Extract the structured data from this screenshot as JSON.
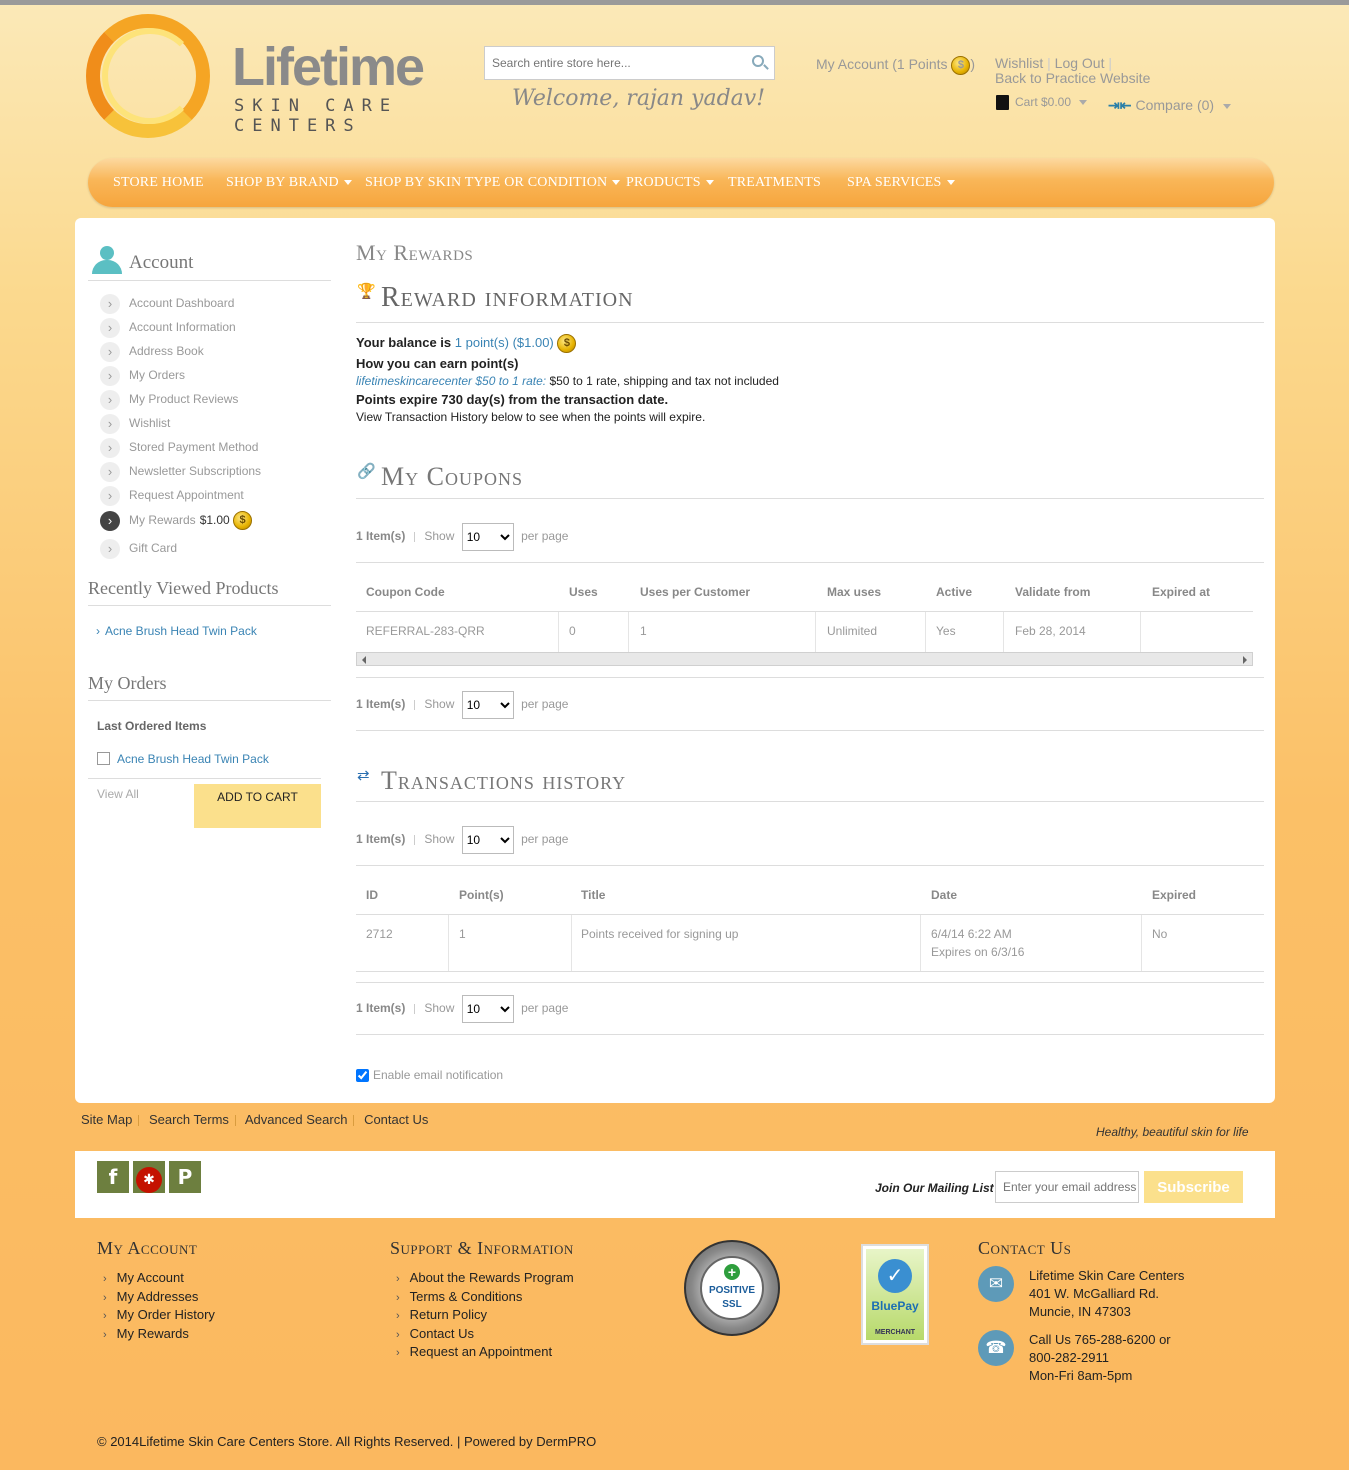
{
  "header": {
    "logo_title": "Lifetime",
    "logo_subtitle": "SKIN CARE CENTERS",
    "search_placeholder": "Search entire store here...",
    "welcome": "Welcome, rajan yadav!",
    "my_account": "My Account (1 Points",
    "my_account_close": ")",
    "wishlist": "Wishlist",
    "logout": "Log Out",
    "back_link": "Back to Practice Website",
    "cart": "Cart $0.00",
    "compare": "Compare (0)"
  },
  "nav": [
    {
      "label": "STORE HOME"
    },
    {
      "label": "SHOP BY BRAND"
    },
    {
      "label": "SHOP BY SKIN TYPE OR CONDITION"
    },
    {
      "label": "PRODUCTS"
    },
    {
      "label": "TREATMENTS"
    },
    {
      "label": "SPA SERVICES"
    }
  ],
  "sidebar": {
    "account_title": "Account",
    "items": [
      {
        "label": "Account Dashboard"
      },
      {
        "label": "Account Information"
      },
      {
        "label": "Address Book"
      },
      {
        "label": "My Orders"
      },
      {
        "label": "My Product Reviews"
      },
      {
        "label": "Wishlist"
      },
      {
        "label": "Stored Payment Method"
      },
      {
        "label": "Newsletter Subscriptions"
      },
      {
        "label": "Request Appointment"
      },
      {
        "label": "My Rewards",
        "value": "$1.00"
      },
      {
        "label": "Gift Card"
      }
    ],
    "recently_viewed_title": "Recently Viewed Products",
    "recently_viewed_item": "Acne Brush Head Twin Pack",
    "my_orders_title": "My Orders",
    "last_ordered": "Last Ordered Items",
    "last_ordered_item": "Acne Brush Head Twin Pack",
    "view_all": "View All",
    "add_to_cart": "ADD TO CART"
  },
  "content": {
    "page_title": "My Rewards",
    "reward_title": "Reward information",
    "balance_prefix": "Your balance is",
    "balance_value": "1 point(s) ($1.00)",
    "earn_title": "How you can earn point(s)",
    "earn_rule_link": "lifetimeskincarecenter $50 to 1 rate:",
    "earn_rule_text": "$50 to 1 rate, shipping and tax not included",
    "expire_text": "Points expire 730 day(s) from the transaction date.",
    "view_history": "View Transaction History below to see when the points will expire.",
    "coupons_title": "My Coupons",
    "transactions_title": "Transactions history",
    "pager": {
      "items": "1 Item(s)",
      "show": "Show",
      "per_page": "per page",
      "selected": "10"
    },
    "coupon_headers": [
      "Coupon Code",
      "Uses",
      "Uses per Customer",
      "Max uses",
      "Active",
      "Validate from",
      "Expired at"
    ],
    "coupon_row": [
      "REFERRAL-283-QRR",
      "0",
      "1",
      "Unlimited",
      "Yes",
      "Feb 28, 2014",
      ""
    ],
    "tx_headers": [
      "ID",
      "Point(s)",
      "Title",
      "Date",
      "Expired"
    ],
    "tx_row": {
      "id": "2712",
      "points": "1",
      "title": "Points received for signing up",
      "date": "6/4/14 6:22 AM",
      "expires": "Expires on 6/3/16",
      "expired": "No"
    },
    "email_notification": "Enable email notification"
  },
  "footer": {
    "links": [
      "Site Map",
      "Search Terms",
      "Advanced Search",
      "Contact Us"
    ],
    "tagline": "Healthy, beautiful skin for life",
    "social": [
      {
        "icon": "facebook-icon",
        "glyph": "f"
      },
      {
        "icon": "yelp-icon",
        "glyph": "✱"
      },
      {
        "icon": "pinterest-icon",
        "glyph": "P"
      }
    ],
    "mailing_label": "Join Our Mailing List",
    "email_placeholder": "Enter your email address",
    "subscribe": "Subscribe",
    "my_account_title": "My Account",
    "my_account_links": [
      "My Account",
      "My Addresses",
      "My Order History",
      "My Rewards"
    ],
    "support_title": "Support & Information",
    "support_links": [
      "About the Rewards Program",
      "Terms & Conditions",
      "Return Policy",
      "Contact Us",
      "Request an Appointment"
    ],
    "ssl_text": "POSITIVE SSL",
    "bluepay_text": "BluePay",
    "bluepay_sub": "MERCHANT",
    "contact_title": "Contact Us",
    "address": [
      "Lifetime Skin Care Centers",
      "401 W. McGalliard Rd.",
      "Muncie, IN 47303"
    ],
    "phone": [
      "Call Us 765-288-6200 or",
      "800-282-2911",
      "Mon-Fri 8am-5pm"
    ],
    "copyright": "© 2014Lifetime Skin Care Centers Store. All Rights Reserved. | Powered by DermPRO"
  },
  "colors": {
    "accent": "#f6a53d",
    "link": "#3a84b4",
    "button": "#fbe08c"
  }
}
